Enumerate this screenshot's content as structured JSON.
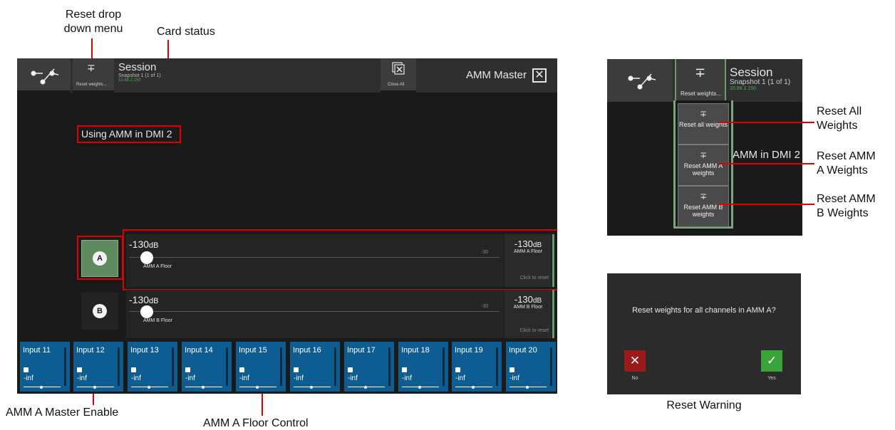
{
  "annotations": {
    "reset_drop_down": "Reset drop\ndown menu",
    "card_status": "Card status",
    "amm_a_master_enable": "AMM A Master Enable",
    "amm_a_floor_control": "AMM A Floor Control",
    "reset_all_weights": "Reset All\nWeights",
    "reset_amm_a_weights": "Reset AMM\nA Weights",
    "reset_amm_b_weights": "Reset AMM\nB Weights",
    "reset_warning": "Reset Warning"
  },
  "toolbar": {
    "network_icon": "network-icon",
    "reset_weights_label": "Reset weights...",
    "session_title": "Session",
    "session_snapshot": "Snapshot 1 (1 of 1)",
    "session_ip": "10.88.2.150",
    "close_all_label": "Close All",
    "window_title": "AMM Master",
    "close_icon": "close-icon"
  },
  "status": {
    "text": "Using AMM in DMI 2"
  },
  "amm_a": {
    "enable_label": "A",
    "value": "-130",
    "unit": "dB",
    "name": "AMM A Floor",
    "scale_mark": "-30",
    "side_value": "-130",
    "side_unit": "dB",
    "side_name": "AMM A Floor",
    "click_to_reset": "Click to reset"
  },
  "amm_b": {
    "enable_label": "B",
    "value": "-130",
    "unit": "dB",
    "name": "AMM B Floor",
    "scale_mark": "-30",
    "side_value": "-130",
    "side_unit": "dB",
    "side_name": "AMM B Floor",
    "click_to_reset": "Click to reset"
  },
  "inputs": [
    {
      "name": "Input 11",
      "level": "-inf"
    },
    {
      "name": "Input 12",
      "level": "-inf"
    },
    {
      "name": "Input 13",
      "level": "-inf"
    },
    {
      "name": "Input 14",
      "level": "-inf"
    },
    {
      "name": "Input 15",
      "level": "-inf"
    },
    {
      "name": "Input 16",
      "level": "-inf"
    },
    {
      "name": "Input 17",
      "level": "-inf"
    },
    {
      "name": "Input 18",
      "level": "-inf"
    },
    {
      "name": "Input 19",
      "level": "-inf"
    },
    {
      "name": "Input 20",
      "level": "-inf"
    }
  ],
  "reset_menu": {
    "session_title": "Session",
    "session_snapshot": "Snapshot 1 (1 of 1)",
    "session_ip": "10.88.2.150",
    "reset_weights_label": "Reset weights...",
    "background_text": "AMM in DMI 2",
    "items": [
      {
        "label": "Reset all weights"
      },
      {
        "label": "Reset AMM A weights"
      },
      {
        "label": "Reset AMM B weights"
      }
    ]
  },
  "reset_warning": {
    "message": "Reset weights for all channels in AMM A?",
    "no_label": "No",
    "yes_label": "Yes"
  },
  "colors": {
    "accent_green": "#6b9a6b",
    "input_blue": "#0d5d93",
    "annotation_red": "#e00000",
    "no_red": "#9b1b1b",
    "yes_green": "#3aa33a"
  }
}
